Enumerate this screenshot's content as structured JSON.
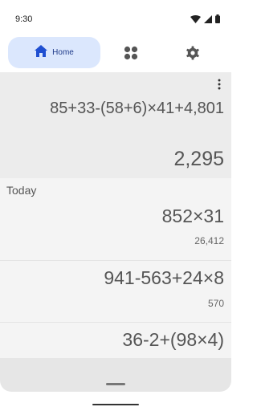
{
  "status_bar": {
    "time": "9:30"
  },
  "nav": {
    "home_label": "Home",
    "items": [
      "home-icon",
      "grid-icon",
      "gear-icon"
    ],
    "accent": "#dbe7fd",
    "home_icon_color": "#1f4fd1"
  },
  "current": {
    "expression": "85+33-(58+6)×41+4,801",
    "result": "2,295"
  },
  "history": {
    "section_label": "Today",
    "entries": [
      {
        "expression": "852×31",
        "result": "26,412"
      },
      {
        "expression": "941-563+24×8",
        "result": "570"
      },
      {
        "expression": "36-2+(98×4)",
        "result": ""
      }
    ]
  }
}
